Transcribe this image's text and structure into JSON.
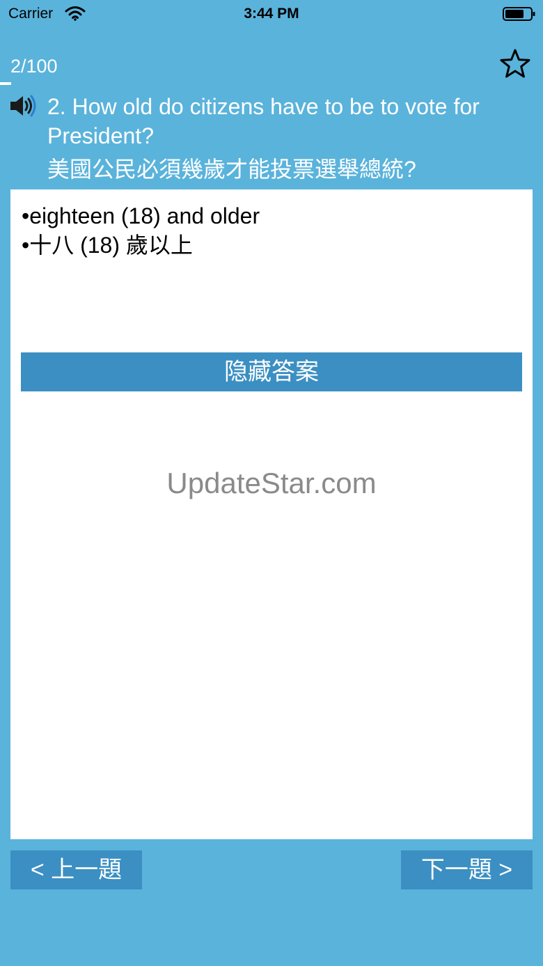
{
  "status_bar": {
    "carrier": "Carrier",
    "time": "3:44 PM",
    "wifi_icon": "wifi-icon",
    "battery_icon": "battery-icon"
  },
  "header": {
    "progress_label": "2/100",
    "progress_fraction": 0.02,
    "favorite_icon": "star-outline-icon",
    "audio_icon": "speaker-icon"
  },
  "question": {
    "english": "2. How old do citizens have to be to vote for President?",
    "chinese": "美國公民必須幾歲才能投票選舉總統?"
  },
  "answer": {
    "lines": [
      "•eighteen (18) and older",
      "•十八 (18) 歲以上"
    ],
    "hide_button_label": "隐藏答案"
  },
  "watermark": "UpdateStar.com",
  "navigation": {
    "prev_label": "< 上一題",
    "next_label": "下一題 >"
  },
  "colors": {
    "background": "#5ab3db",
    "button": "#3b8fc2",
    "card": "#ffffff",
    "text_light": "#ffffff"
  }
}
